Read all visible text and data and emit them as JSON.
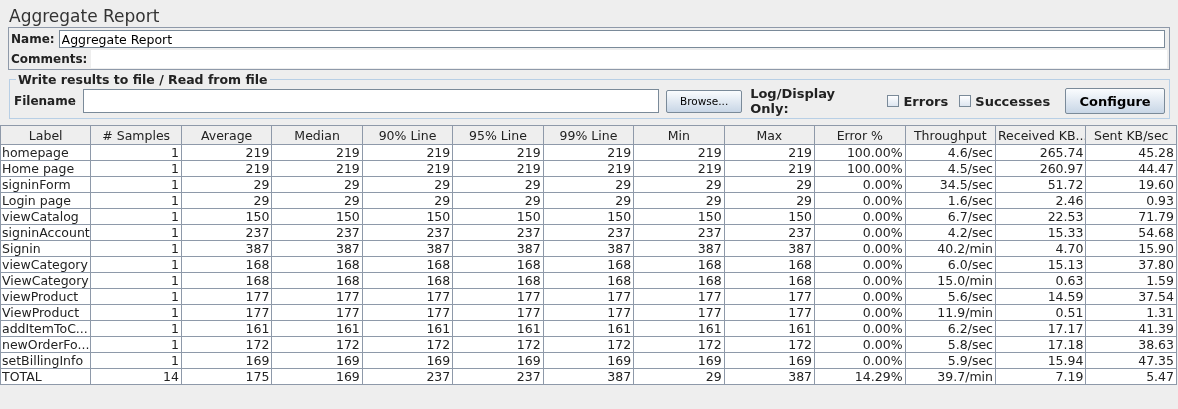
{
  "title": "Aggregate Report",
  "name_field": {
    "label": "Name:",
    "value": "Aggregate Report"
  },
  "comments_field": {
    "label": "Comments:"
  },
  "file_group": {
    "legend": "Write results to file / Read from file",
    "filename_label": "Filename",
    "browse_button": "Browse...",
    "log_label": "Log/Display Only:",
    "options": [
      {
        "label": "Errors",
        "checked": false
      },
      {
        "label": "Successes",
        "checked": false
      }
    ],
    "configure_button": "Configure"
  },
  "table": {
    "columns": [
      "Label",
      "# Samples",
      "Average",
      "Median",
      "90% Line",
      "95% Line",
      "99% Line",
      "Min",
      "Max",
      "Error %",
      "Throughput",
      "Received KB...",
      "Sent KB/sec"
    ],
    "rows": [
      [
        "homepage",
        "1",
        "219",
        "219",
        "219",
        "219",
        "219",
        "219",
        "219",
        "100.00%",
        "4.6/sec",
        "265.74",
        "45.28"
      ],
      [
        "Home page",
        "1",
        "219",
        "219",
        "219",
        "219",
        "219",
        "219",
        "219",
        "100.00%",
        "4.5/sec",
        "260.97",
        "44.47"
      ],
      [
        "signinForm",
        "1",
        "29",
        "29",
        "29",
        "29",
        "29",
        "29",
        "29",
        "0.00%",
        "34.5/sec",
        "51.72",
        "19.60"
      ],
      [
        "Login page",
        "1",
        "29",
        "29",
        "29",
        "29",
        "29",
        "29",
        "29",
        "0.00%",
        "1.6/sec",
        "2.46",
        "0.93"
      ],
      [
        "viewCatalog",
        "1",
        "150",
        "150",
        "150",
        "150",
        "150",
        "150",
        "150",
        "0.00%",
        "6.7/sec",
        "22.53",
        "71.79"
      ],
      [
        "signinAccount",
        "1",
        "237",
        "237",
        "237",
        "237",
        "237",
        "237",
        "237",
        "0.00%",
        "4.2/sec",
        "15.33",
        "54.68"
      ],
      [
        "Signin",
        "1",
        "387",
        "387",
        "387",
        "387",
        "387",
        "387",
        "387",
        "0.00%",
        "40.2/min",
        "4.70",
        "15.90"
      ],
      [
        "viewCategory",
        "1",
        "168",
        "168",
        "168",
        "168",
        "168",
        "168",
        "168",
        "0.00%",
        "6.0/sec",
        "15.13",
        "37.80"
      ],
      [
        "ViewCategory",
        "1",
        "168",
        "168",
        "168",
        "168",
        "168",
        "168",
        "168",
        "0.00%",
        "15.0/min",
        "0.63",
        "1.59"
      ],
      [
        "viewProduct",
        "1",
        "177",
        "177",
        "177",
        "177",
        "177",
        "177",
        "177",
        "0.00%",
        "5.6/sec",
        "14.59",
        "37.54"
      ],
      [
        "ViewProduct",
        "1",
        "177",
        "177",
        "177",
        "177",
        "177",
        "177",
        "177",
        "0.00%",
        "11.9/min",
        "0.51",
        "1.31"
      ],
      [
        "addItemToC...",
        "1",
        "161",
        "161",
        "161",
        "161",
        "161",
        "161",
        "161",
        "0.00%",
        "6.2/sec",
        "17.17",
        "41.39"
      ],
      [
        "newOrderFo...",
        "1",
        "172",
        "172",
        "172",
        "172",
        "172",
        "172",
        "172",
        "0.00%",
        "5.8/sec",
        "17.18",
        "38.63"
      ],
      [
        "setBillingInfo",
        "1",
        "169",
        "169",
        "169",
        "169",
        "169",
        "169",
        "169",
        "0.00%",
        "5.9/sec",
        "15.94",
        "47.35"
      ],
      [
        "TOTAL",
        "14",
        "175",
        "169",
        "237",
        "237",
        "387",
        "29",
        "387",
        "14.29%",
        "39.7/min",
        "7.19",
        "5.47"
      ]
    ]
  }
}
